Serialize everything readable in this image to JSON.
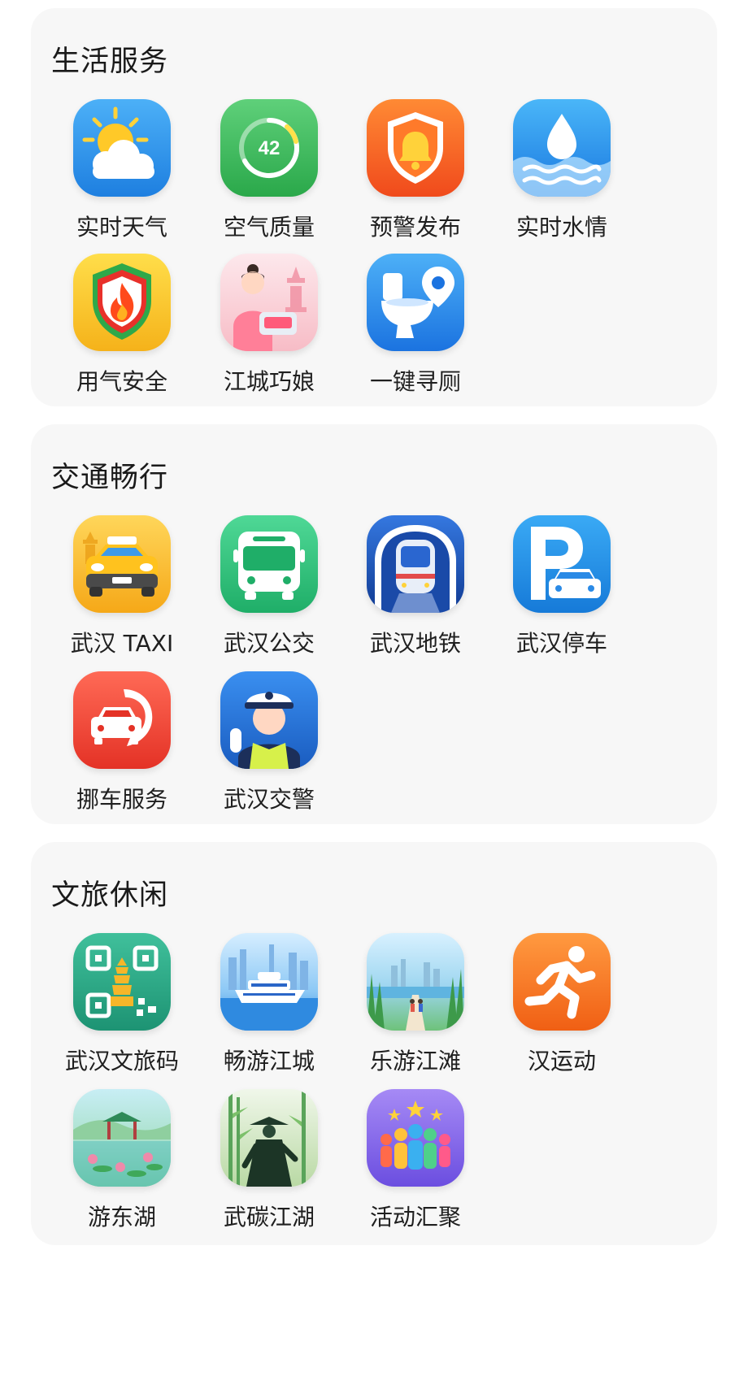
{
  "sections": [
    {
      "title": "生活服务",
      "items": [
        {
          "label": "实时天气",
          "icon": "weather-icon",
          "colors": [
            "#3aa0f0",
            "#1e7fe0"
          ]
        },
        {
          "label": "空气质量",
          "icon": "air-quality-gauge-icon",
          "colors": [
            "#53c86a",
            "#2aa84a"
          ],
          "gauge_value": "42"
        },
        {
          "label": "预警发布",
          "icon": "warning-bell-shield-icon",
          "colors": [
            "#ff7a2a",
            "#f04a1c"
          ]
        },
        {
          "label": "实时水情",
          "icon": "water-drop-icon",
          "colors": [
            "#3aa8f5",
            "#1a78e0"
          ]
        },
        {
          "label": "用气安全",
          "icon": "gas-safety-flame-shield-icon",
          "colors": [
            "#ffd23a",
            "#f5b21a"
          ]
        },
        {
          "label": "江城巧娘",
          "icon": "seamstress-icon",
          "colors": [
            "#fde2e6",
            "#f7bcc6"
          ]
        },
        {
          "label": "一键寻厕",
          "icon": "toilet-locator-icon",
          "colors": [
            "#3ea2f5",
            "#1b73e0"
          ]
        }
      ]
    },
    {
      "title": "交通畅行",
      "items": [
        {
          "label": "武汉 TAXI",
          "icon": "taxi-icon",
          "colors": [
            "#ffcf48",
            "#f5a818"
          ]
        },
        {
          "label": "武汉公交",
          "icon": "bus-icon",
          "colors": [
            "#3fcf8a",
            "#1fae68"
          ]
        },
        {
          "label": "武汉地铁",
          "icon": "metro-train-icon",
          "colors": [
            "#2e6fd8",
            "#123f9e"
          ]
        },
        {
          "label": "武汉停车",
          "icon": "parking-icon",
          "colors": [
            "#2ea0f0",
            "#167ad8"
          ]
        },
        {
          "label": "挪车服务",
          "icon": "move-car-phone-icon",
          "colors": [
            "#ff5a4a",
            "#e43226"
          ]
        },
        {
          "label": "武汉交警",
          "icon": "traffic-police-icon",
          "colors": [
            "#2f82e6",
            "#1a5cc0"
          ]
        }
      ]
    },
    {
      "title": "文旅休闲",
      "items": [
        {
          "label": "武汉文旅码",
          "icon": "qr-code-tower-icon",
          "colors": [
            "#34b38f",
            "#1d9373"
          ]
        },
        {
          "label": "畅游江城",
          "icon": "cruise-ship-icon",
          "colors": [
            "#bfe3ff",
            "#4aa6ee"
          ]
        },
        {
          "label": "乐游江滩",
          "icon": "riverside-walk-icon",
          "colors": [
            "#cdeeff",
            "#88cf8a"
          ]
        },
        {
          "label": "汉运动",
          "icon": "runner-icon",
          "colors": [
            "#ff8a33",
            "#f05f14"
          ]
        },
        {
          "label": "游东湖",
          "icon": "east-lake-pavilion-icon",
          "colors": [
            "#bfeaf0",
            "#7ccf96"
          ]
        },
        {
          "label": "武碳江湖",
          "icon": "swordsman-bamboo-icon",
          "colors": [
            "#e9f3e2",
            "#b9d9a4"
          ]
        },
        {
          "label": "活动汇聚",
          "icon": "crowd-stars-icon",
          "colors": [
            "#9d7bf0",
            "#6b4ee0"
          ]
        }
      ]
    }
  ]
}
